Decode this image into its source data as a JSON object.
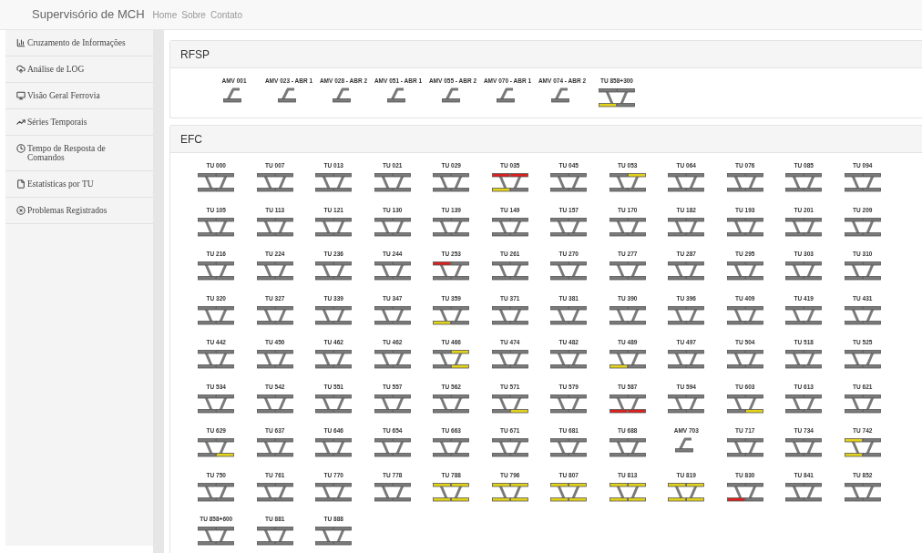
{
  "navbar": {
    "brand": "Supervisório de MCH",
    "links": [
      "Home",
      "Sobre",
      "Contato"
    ]
  },
  "sidebar": {
    "items": [
      {
        "label": "Cruzamento de Informações"
      },
      {
        "label": "Análise de LOG"
      },
      {
        "label": "Visão Geral Ferrovia"
      },
      {
        "label": "Séries Temporais"
      },
      {
        "label": "Tempo de Resposta de Comandos"
      },
      {
        "label": "Estatísticas por TU"
      },
      {
        "label": "Problemas Registrados"
      }
    ]
  },
  "panels": [
    {
      "title": "RFSP",
      "items": [
        {
          "label": "AMV 001",
          "kind": "amv"
        },
        {
          "label": "AMV 023 - ABR 1",
          "kind": "amv"
        },
        {
          "label": "AMV 028 - ABR 2",
          "kind": "amv"
        },
        {
          "label": "AMV 051 - ABR 1",
          "kind": "amv"
        },
        {
          "label": "AMV 055 - ABR 2",
          "kind": "amv"
        },
        {
          "label": "AMV 070 - ABR 1",
          "kind": "amv"
        },
        {
          "label": "AMV 074 - ABR 2",
          "kind": "amv"
        },
        {
          "label": "TU 858+300",
          "kind": "tu",
          "segments": [
            {
              "color": "#7a7a7a"
            },
            {
              "color": "#7a7a7a"
            },
            {
              "color": "#e3d21c"
            },
            {
              "color": "#7a7a7a"
            }
          ]
        }
      ]
    },
    {
      "title": "EFC",
      "items": [
        {
          "label": "TU 000",
          "kind": "tu"
        },
        {
          "label": "TU 007",
          "kind": "tu"
        },
        {
          "label": "TU 013",
          "kind": "tu"
        },
        {
          "label": "TU 021",
          "kind": "tu"
        },
        {
          "label": "TU 029",
          "kind": "tu"
        },
        {
          "label": "TU 035",
          "kind": "tu",
          "segments": [
            {
              "color": "#d9211f"
            },
            {
              "color": "#d9211f"
            },
            {
              "color": "#e3d21c"
            },
            {
              "color": "#7a7a7a"
            }
          ]
        },
        {
          "label": "TU 045",
          "kind": "tu"
        },
        {
          "label": "TU 053",
          "kind": "tu",
          "segments": [
            {
              "color": "#7a7a7a"
            },
            {
              "color": "#e3d21c"
            },
            {
              "color": "#7a7a7a"
            },
            {
              "color": "#7a7a7a"
            }
          ]
        },
        {
          "label": "TU 064",
          "kind": "tu"
        },
        {
          "label": "TU 076",
          "kind": "tu"
        },
        {
          "label": "TU 085",
          "kind": "tu"
        },
        {
          "label": "TU 094",
          "kind": "tu"
        },
        {
          "label": "TU 105",
          "kind": "tu"
        },
        {
          "label": "TU 113",
          "kind": "tu"
        },
        {
          "label": "TU 121",
          "kind": "tu"
        },
        {
          "label": "TU 130",
          "kind": "tu"
        },
        {
          "label": "TU 139",
          "kind": "tu"
        },
        {
          "label": "TU 149",
          "kind": "tu"
        },
        {
          "label": "TU 157",
          "kind": "tu"
        },
        {
          "label": "TU 170",
          "kind": "tu"
        },
        {
          "label": "TU 182",
          "kind": "tu"
        },
        {
          "label": "TU 193",
          "kind": "tu"
        },
        {
          "label": "TU 201",
          "kind": "tu"
        },
        {
          "label": "TU 209",
          "kind": "tu"
        },
        {
          "label": "TU 216",
          "kind": "tu"
        },
        {
          "label": "TU 224",
          "kind": "tu"
        },
        {
          "label": "TU 236",
          "kind": "tu"
        },
        {
          "label": "TU 244",
          "kind": "tu"
        },
        {
          "label": "TU 253",
          "kind": "tu",
          "segments": [
            {
              "color": "#d9211f"
            },
            {
              "color": "#7a7a7a"
            },
            {
              "color": "#7a7a7a"
            },
            {
              "color": "#7a7a7a"
            }
          ]
        },
        {
          "label": "TU 261",
          "kind": "tu"
        },
        {
          "label": "TU 270",
          "kind": "tu"
        },
        {
          "label": "TU 277",
          "kind": "tu"
        },
        {
          "label": "TU 287",
          "kind": "tu"
        },
        {
          "label": "TU 295",
          "kind": "tu"
        },
        {
          "label": "TU 303",
          "kind": "tu"
        },
        {
          "label": "TU 310",
          "kind": "tu"
        },
        {
          "label": "TU 320",
          "kind": "tu"
        },
        {
          "label": "TU 327",
          "kind": "tu"
        },
        {
          "label": "TU 339",
          "kind": "tu"
        },
        {
          "label": "TU 347",
          "kind": "tu"
        },
        {
          "label": "TU 359",
          "kind": "tu",
          "segments": [
            {
              "color": "#7a7a7a"
            },
            {
              "color": "#7a7a7a"
            },
            {
              "color": "#e3d21c"
            },
            {
              "color": "#7a7a7a"
            }
          ]
        },
        {
          "label": "TU 371",
          "kind": "tu"
        },
        {
          "label": "TU 381",
          "kind": "tu"
        },
        {
          "label": "TU 390",
          "kind": "tu"
        },
        {
          "label": "TU 396",
          "kind": "tu"
        },
        {
          "label": "TU 409",
          "kind": "tu"
        },
        {
          "label": "TU 419",
          "kind": "tu"
        },
        {
          "label": "TU 431",
          "kind": "tu"
        },
        {
          "label": "TU 442",
          "kind": "tu"
        },
        {
          "label": "TU 450",
          "kind": "tu"
        },
        {
          "label": "TU 462",
          "kind": "tu"
        },
        {
          "label": "TU 462",
          "kind": "tu"
        },
        {
          "label": "TU 466",
          "kind": "tu",
          "segments": [
            {
              "color": "#7a7a7a"
            },
            {
              "color": "#e3d21c"
            },
            {
              "color": "#7a7a7a"
            },
            {
              "color": "#e3d21c"
            }
          ]
        },
        {
          "label": "TU 474",
          "kind": "tu"
        },
        {
          "label": "TU 482",
          "kind": "tu"
        },
        {
          "label": "TU 489",
          "kind": "tu",
          "segments": [
            {
              "color": "#7a7a7a"
            },
            {
              "color": "#7a7a7a"
            },
            {
              "color": "#e3d21c"
            },
            {
              "color": "#7a7a7a"
            }
          ]
        },
        {
          "label": "TU 497",
          "kind": "tu"
        },
        {
          "label": "TU 504",
          "kind": "tu"
        },
        {
          "label": "TU 518",
          "kind": "tu"
        },
        {
          "label": "TU 525",
          "kind": "tu"
        },
        {
          "label": "TU 534",
          "kind": "tu"
        },
        {
          "label": "TU 542",
          "kind": "tu"
        },
        {
          "label": "TU 551",
          "kind": "tu"
        },
        {
          "label": "TU 557",
          "kind": "tu"
        },
        {
          "label": "TU 562",
          "kind": "tu"
        },
        {
          "label": "TU 571",
          "kind": "tu",
          "segments": [
            {
              "color": "#7a7a7a"
            },
            {
              "color": "#7a7a7a"
            },
            {
              "color": "#7a7a7a"
            },
            {
              "color": "#e3d21c"
            }
          ]
        },
        {
          "label": "TU 579",
          "kind": "tu"
        },
        {
          "label": "TU 587",
          "kind": "tu",
          "segments": [
            {
              "color": "#7a7a7a"
            },
            {
              "color": "#7a7a7a"
            },
            {
              "color": "#d9211f"
            },
            {
              "color": "#d9211f"
            }
          ]
        },
        {
          "label": "TU 594",
          "kind": "tu"
        },
        {
          "label": "TU 603",
          "kind": "tu",
          "segments": [
            {
              "color": "#7a7a7a"
            },
            {
              "color": "#7a7a7a"
            },
            {
              "color": "#7a7a7a"
            },
            {
              "color": "#e3d21c"
            }
          ]
        },
        {
          "label": "TU 613",
          "kind": "tu"
        },
        {
          "label": "TU 621",
          "kind": "tu"
        },
        {
          "label": "TU 629",
          "kind": "tu",
          "segments": [
            {
              "color": "#7a7a7a"
            },
            {
              "color": "#7a7a7a"
            },
            {
              "color": "#7a7a7a"
            },
            {
              "color": "#e3d21c"
            }
          ]
        },
        {
          "label": "TU 637",
          "kind": "tu"
        },
        {
          "label": "TU 646",
          "kind": "tu"
        },
        {
          "label": "TU 654",
          "kind": "tu"
        },
        {
          "label": "TU 663",
          "kind": "tu"
        },
        {
          "label": "TU 671",
          "kind": "tu"
        },
        {
          "label": "TU 681",
          "kind": "tu"
        },
        {
          "label": "TU 688",
          "kind": "tu"
        },
        {
          "label": "AMV 703",
          "kind": "amv"
        },
        {
          "label": "TU 717",
          "kind": "tu"
        },
        {
          "label": "TU 734",
          "kind": "tu"
        },
        {
          "label": "TU 742",
          "kind": "tu",
          "segments": [
            {
              "color": "#e3d21c"
            },
            {
              "color": "#7a7a7a"
            },
            {
              "color": "#e3d21c"
            },
            {
              "color": "#7a7a7a"
            }
          ]
        },
        {
          "label": "TU 750",
          "kind": "tu"
        },
        {
          "label": "TU 761",
          "kind": "tu"
        },
        {
          "label": "TU 770",
          "kind": "tu"
        },
        {
          "label": "TU 778",
          "kind": "tu"
        },
        {
          "label": "TU 788",
          "kind": "tu",
          "segments": [
            {
              "color": "#e3d21c"
            },
            {
              "color": "#e3d21c"
            },
            {
              "color": "#e3d21c"
            },
            {
              "color": "#e3d21c"
            }
          ]
        },
        {
          "label": "TU 796",
          "kind": "tu",
          "segments": [
            {
              "color": "#e3d21c"
            },
            {
              "color": "#e3d21c"
            },
            {
              "color": "#e3d21c"
            },
            {
              "color": "#e3d21c"
            }
          ]
        },
        {
          "label": "TU 807",
          "kind": "tu",
          "segments": [
            {
              "color": "#e3d21c"
            },
            {
              "color": "#e3d21c"
            },
            {
              "color": "#e3d21c"
            },
            {
              "color": "#e3d21c"
            }
          ]
        },
        {
          "label": "TU 813",
          "kind": "tu",
          "segments": [
            {
              "color": "#e3d21c"
            },
            {
              "color": "#e3d21c"
            },
            {
              "color": "#e3d21c"
            },
            {
              "color": "#e3d21c"
            }
          ]
        },
        {
          "label": "TU 819",
          "kind": "tu",
          "segments": [
            {
              "color": "#e3d21c"
            },
            {
              "color": "#e3d21c"
            },
            {
              "color": "#e3d21c"
            },
            {
              "color": "#e3d21c"
            }
          ]
        },
        {
          "label": "TU 830",
          "kind": "tu",
          "segments": [
            {
              "color": "#7a7a7a"
            },
            {
              "color": "#7a7a7a"
            },
            {
              "color": "#d9211f"
            },
            {
              "color": "#7a7a7a"
            }
          ]
        },
        {
          "label": "TU 841",
          "kind": "tu"
        },
        {
          "label": "TU 852",
          "kind": "tu"
        },
        {
          "label": "TU 858+600",
          "kind": "tu"
        },
        {
          "label": "TU 881",
          "kind": "tu"
        },
        {
          "label": "TU 888",
          "kind": "tu"
        }
      ]
    }
  ]
}
